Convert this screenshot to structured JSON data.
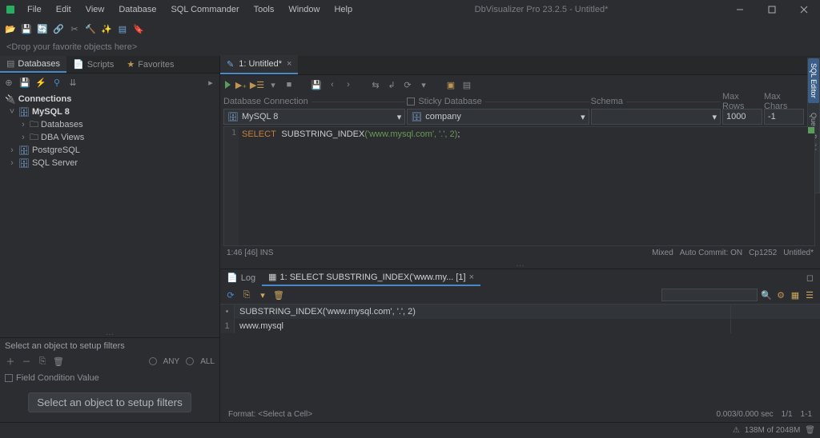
{
  "menu": {
    "file": "File",
    "edit": "Edit",
    "view": "View",
    "database": "Database",
    "sqlcmd": "SQL Commander",
    "tools": "Tools",
    "window": "Window",
    "help": "Help"
  },
  "app_title": "DbVisualizer Pro 23.2.5 - Untitled*",
  "fav_hint": "<Drop your favorite objects here>",
  "left_tabs": {
    "databases": "Databases",
    "scripts": "Scripts",
    "favorites": "Favorites"
  },
  "tree": {
    "root": "Connections",
    "mysql": "MySQL 8",
    "dbs": "Databases",
    "dba": "DBA Views",
    "postgres": "PostgreSQL",
    "sqlserver": "SQL Server"
  },
  "filter": {
    "title": "Select an object to setup filters",
    "any": "ANY",
    "all": "ALL",
    "cond": "Field Condition Value",
    "button": "Select an object to setup filters"
  },
  "editor_tab": {
    "label": "1: Untitled*"
  },
  "conn_labels": {
    "conn": "Database Connection",
    "sticky": "Sticky Database",
    "schema": "Schema",
    "maxrows": "Max Rows",
    "maxchars": "Max Chars"
  },
  "conn_values": {
    "conn": "MySQL 8",
    "db": "company",
    "maxrows": "1000",
    "maxchars": "-1"
  },
  "sql": {
    "line": "1",
    "kw": "SELECT",
    "fn": "SUBSTRING_INDEX",
    "args": "('www.mysql.com', '.', 2)",
    "semi": ";"
  },
  "sql_status": {
    "left": "1:46 [46]   INS",
    "mixed": "Mixed",
    "autocommit": "Auto Commit: ON",
    "enc": "Cp1252",
    "file": "Untitled*"
  },
  "bottom_tabs": {
    "log": "Log",
    "result": "1: SELECT SUBSTRING_INDEX('www.my... [1]"
  },
  "grid": {
    "header": "SUBSTRING_INDEX('www.mysql.com', '.', 2)",
    "row1_num": "1",
    "row1_val": "www.mysql"
  },
  "result_footer": {
    "format": "Format: <Select a Cell>",
    "time": "0.003/0.000 sec",
    "rows": "1/1",
    "range": "1-1"
  },
  "statusbar": {
    "mem": "138M of 2048M"
  },
  "side_vertical": {
    "editor": "SQL Editor",
    "builder": "Query Builder"
  }
}
